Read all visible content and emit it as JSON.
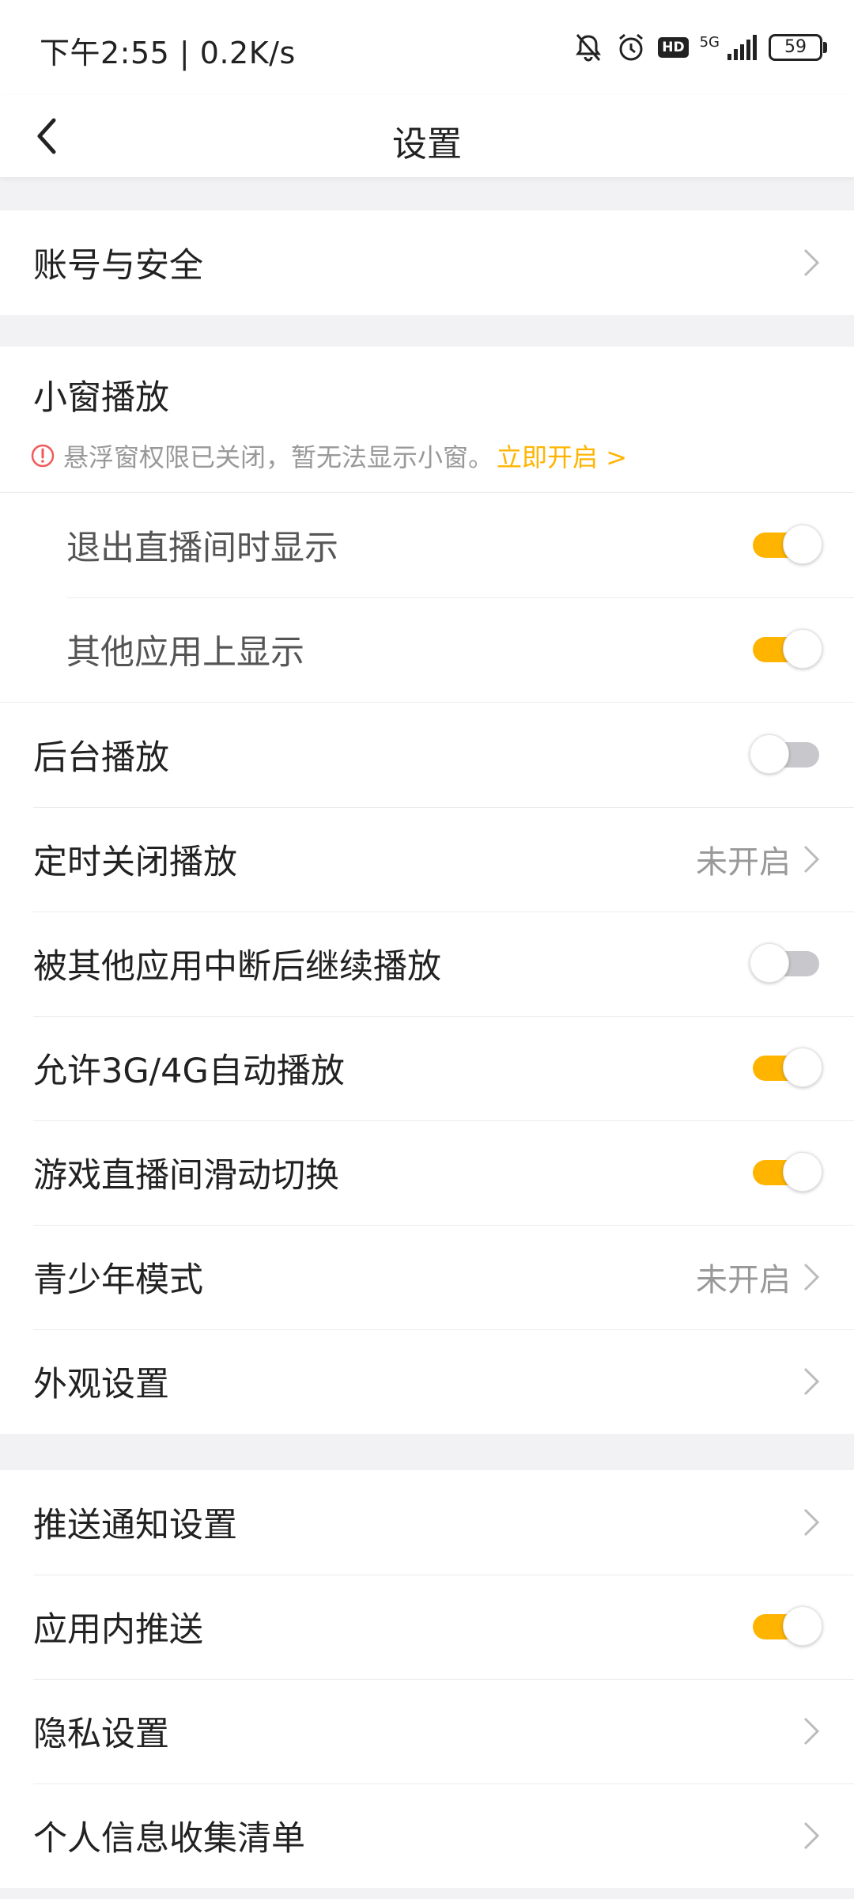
{
  "status_bar": {
    "time_speed": "下午2:55 | 0.2K/s",
    "network": "5G",
    "hd": "HD",
    "battery": "59"
  },
  "header": {
    "title": "设置"
  },
  "account": {
    "label": "账号与安全"
  },
  "pip": {
    "title": "小窗播放",
    "warning": "悬浮窗权限已关闭，暂无法显示小窗。",
    "enable_link": "立即开启 >",
    "items": [
      {
        "label": "退出直播间时显示",
        "on": true
      },
      {
        "label": "其他应用上显示",
        "on": true
      }
    ]
  },
  "playback": {
    "background_play": {
      "label": "后台播放",
      "on": false
    },
    "timer_close": {
      "label": "定时关闭播放",
      "value": "未开启"
    },
    "resume_after_interrupt": {
      "label": "被其他应用中断后继续播放",
      "on": false
    },
    "allow_mobile_autoplay": {
      "label": "允许3G/4G自动播放",
      "on": true
    },
    "swipe_switch": {
      "label": "游戏直播间滑动切换",
      "on": true
    },
    "teen_mode": {
      "label": "青少年模式",
      "value": "未开启"
    },
    "appearance": {
      "label": "外观设置"
    }
  },
  "notifications": {
    "push_settings": {
      "label": "推送通知设置"
    },
    "in_app_push": {
      "label": "应用内推送",
      "on": true
    },
    "privacy": {
      "label": "隐私设置"
    },
    "personal_info": {
      "label": "个人信息收集清单"
    }
  },
  "colors": {
    "accent": "#ffb400",
    "toggle_off": "#c8c8cc",
    "background": "#f2f2f4"
  },
  "icons": [
    "back-arrow-icon",
    "mute-bell-icon",
    "alarm-icon",
    "hd-icon",
    "signal-icon",
    "battery-icon",
    "chevron-right-icon",
    "warning-circle-icon"
  ]
}
